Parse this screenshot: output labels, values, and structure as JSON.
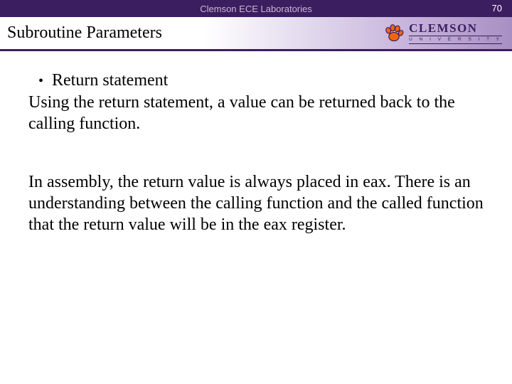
{
  "header": {
    "lab_label": "Clemson ECE Laboratories",
    "page_number": "70"
  },
  "title": "Subroutine Parameters",
  "brand": {
    "name": "CLEMSON",
    "sub": "U N I V E R S I T Y"
  },
  "body": {
    "bullet1": "Return statement",
    "para1": "Using the return statement, a value can be returned back to the calling function.",
    "para2": "In assembly, the return value is always placed in eax. There is an understanding between the calling function and the called function that the return value will be in the eax register."
  }
}
